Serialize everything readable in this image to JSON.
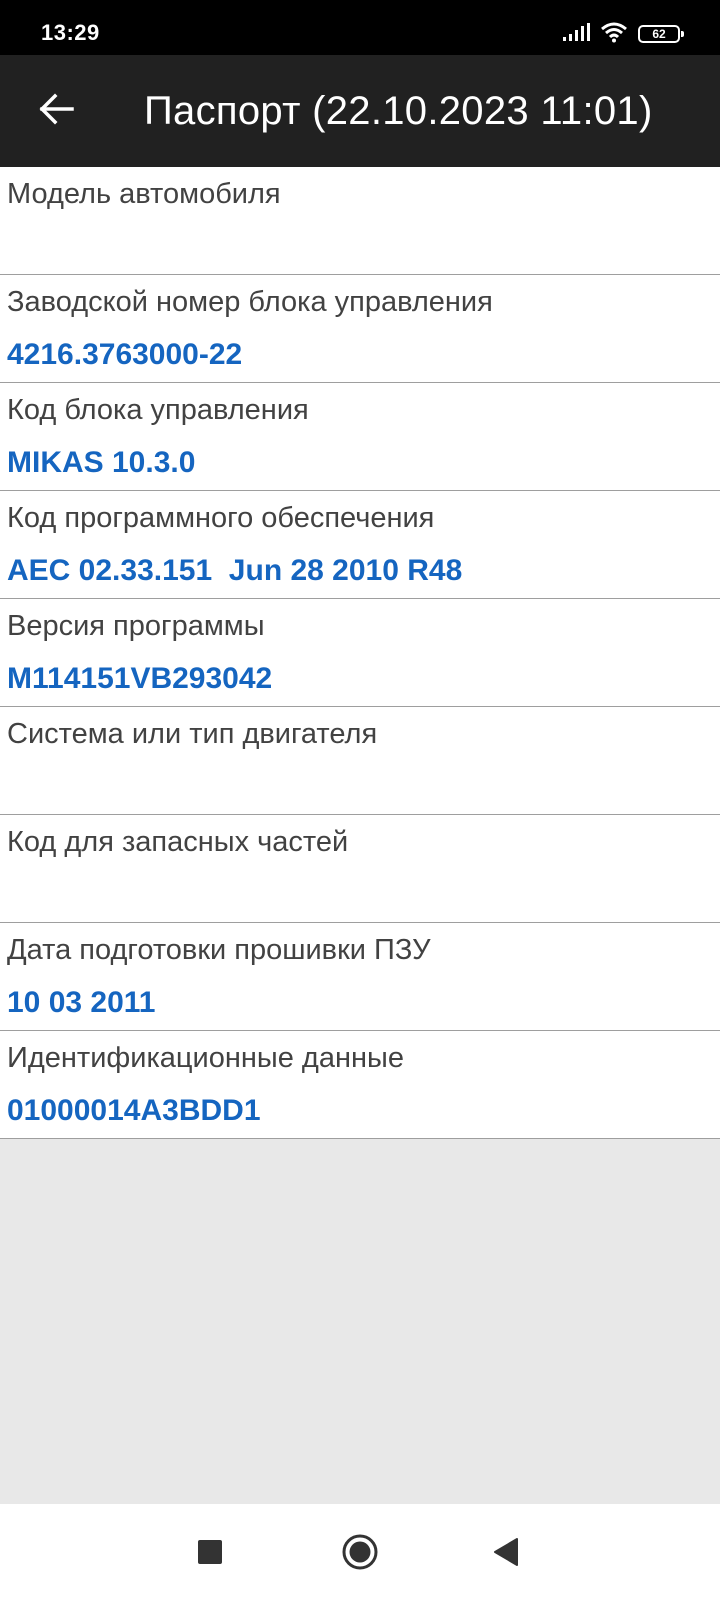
{
  "status_bar": {
    "time": "13:29",
    "battery_level": "62",
    "icons": [
      "signal-icon",
      "wifi-icon",
      "battery-icon"
    ]
  },
  "app_bar": {
    "back_icon": "arrow-back-icon",
    "title": "Паспорт (22.10.2023 11:01)"
  },
  "items": [
    {
      "label": "Модель автомобиля",
      "value": ""
    },
    {
      "label": "Заводской номер блока управления",
      "value": "4216.3763000-22"
    },
    {
      "label": "Код блока управления",
      "value": "MIKAS 10.3.0"
    },
    {
      "label": "Код программного обеспечения",
      "value": "AEC 02.33.151  Jun 28 2010 R48"
    },
    {
      "label": "Версия программы",
      "value": "M114151VB293042"
    },
    {
      "label": "Система или тип двигателя",
      "value": ""
    },
    {
      "label": "Код для запасных частей",
      "value": ""
    },
    {
      "label": "Дата подготовки прошивки ПЗУ",
      "value": "10 03 2011"
    },
    {
      "label": "Идентификационные данные",
      "value": "01000014A3BDD1"
    }
  ],
  "nav_bar": {
    "buttons": [
      "recents-square-icon",
      "home-circle-icon",
      "back-triangle-icon"
    ]
  },
  "colors": {
    "app_bar": "#212121",
    "value_text": "#1565c0",
    "label_text": "#424242",
    "background": "#e8e8e8"
  }
}
